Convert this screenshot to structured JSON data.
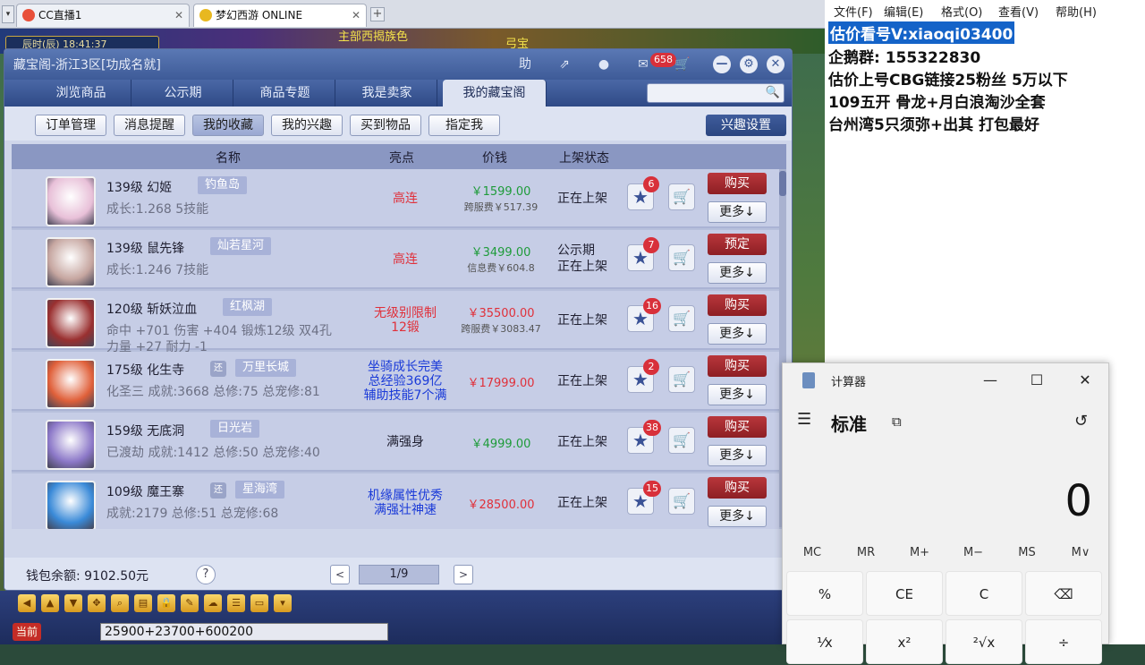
{
  "browser": {
    "tabs": [
      {
        "label": "CC直播1"
      },
      {
        "label": "梦幻西游 ONLINE"
      }
    ],
    "close": "✕",
    "plus": "+",
    "menu": "▾"
  },
  "game": {
    "clock": "辰时(辰)   18:41:37",
    "top_text_1": "主部西揭族色",
    "top_text_2": "弓宝",
    "chat_channel": "当前",
    "chat_text": "25900+23700+600200"
  },
  "window": {
    "title": "藏宝阁-浙江3区[功成名就]",
    "title_icons": {
      "help": "助",
      "pin": "⇗",
      "stop": "●",
      "msg_badge": "658",
      "min": "—",
      "settings": "⚙",
      "close": "✕"
    },
    "nav_tabs": [
      "浏览商品",
      "公示期",
      "商品专题",
      "我是卖家",
      "我的藏宝阁"
    ],
    "active_tab": 4,
    "sub_buttons": [
      "订单管理",
      "消息提醒",
      "我的收藏",
      "我的兴趣",
      "买到物品",
      "指定我"
    ],
    "active_sub": 2,
    "interest_btn": "兴趣设置",
    "columns": [
      "名称",
      "亮点",
      "价钱",
      "上架状态"
    ],
    "rows": [
      {
        "title": "139级 幻姬",
        "server": "钓鱼岛",
        "line2": "成长:1.268 5技能",
        "line3": "",
        "highlight": "高连",
        "hl_color": "red",
        "price": "￥1599.00",
        "price_color": "green",
        "fee": "跨服费￥517.39",
        "status": "正在上架",
        "status2": "",
        "fav_count": "6",
        "action": "购买",
        "more": "更多↓",
        "av": "#e8c0d8"
      },
      {
        "title": "139级 鼠先锋",
        "server": "灿若星河",
        "line2": "成长:1.246 7技能",
        "line3": "",
        "highlight": "高连",
        "hl_color": "red",
        "price": "￥3499.00",
        "price_color": "green",
        "fee": "信息费￥604.8",
        "status": "公示期",
        "status2": "正在上架",
        "fav_count": "7",
        "action": "预定",
        "more": "更多↓",
        "av": "#c6a6a0"
      },
      {
        "title": "120级 斩妖泣血",
        "server": "红枫湖",
        "line2": "命中 +701 伤害 +404 锻炼12级 双4孔",
        "line3": "力量 +27 耐力 -1",
        "highlight": "无级别限制\n12锻",
        "hl_color": "red",
        "price": "￥35500.00",
        "price_color": "red",
        "fee": "跨服费￥3083.47",
        "status": "正在上架",
        "status2": "",
        "fav_count": "16",
        "action": "购买",
        "more": "更多↓",
        "av": "#9a3030"
      },
      {
        "title": "175级 化生寺",
        "tag": "还",
        "server": "万里长城",
        "line2": "化圣三 成就:3668 总修:75 总宠修:81",
        "line3": "",
        "highlight": "坐骑成长完美\n总经验369亿\n辅助技能7个满",
        "hl_color": "blue",
        "price": "￥17999.00",
        "price_color": "red",
        "fee": "",
        "status": "正在上架",
        "status2": "",
        "fav_count": "2",
        "action": "购买",
        "more": "更多↓",
        "av": "#e0603a"
      },
      {
        "title": "159级 无底洞",
        "server": "日光岩",
        "line2": "已渡劫 成就:1412 总修:50 总宠修:40",
        "line3": "",
        "highlight": "满强身",
        "hl_color": "dark",
        "price": "￥4999.00",
        "price_color": "green",
        "fee": "",
        "status": "正在上架",
        "status2": "",
        "fav_count": "38",
        "action": "购买",
        "more": "更多↓",
        "av": "#8c78c8"
      },
      {
        "title": "109级 魔王寨",
        "tag": "还",
        "server": "星海湾",
        "line2": "成就:2179 总修:51 总宠修:68",
        "line3": "",
        "highlight": "机缘属性优秀\n满强壮神速",
        "hl_color": "blue",
        "price": "￥28500.00",
        "price_color": "red",
        "fee": "",
        "status": "正在上架",
        "status2": "",
        "fav_count": "15",
        "action": "购买",
        "more": "更多↓",
        "av": "#3a8ad8"
      }
    ],
    "wallet": "钱包余额: 9102.50元",
    "help": "?",
    "page": "1/9",
    "prev": "<",
    "next": ">",
    "star": "★",
    "cart": "🛒"
  },
  "notepad": {
    "menu": [
      "文件(F)",
      "编辑(E)",
      "格式(O)",
      "查看(V)",
      "帮助(H)"
    ],
    "lines": [
      "估价看号V:xiaoqi03400",
      "企鹅群:  155322830",
      "估价上号CBG链接25粉丝 5万以下",
      "109五开 骨龙+月白浪淘沙全套",
      "台州湾5只须弥+出其 打包最好"
    ]
  },
  "calculator": {
    "title": "计算器",
    "mode": "标准",
    "display": "0",
    "min": "—",
    "max": "☐",
    "close": "✕",
    "menu_icon": "☰",
    "pin_icon": "⧉",
    "history_icon": "↺",
    "memory": [
      "MC",
      "MR",
      "M+",
      "M−",
      "MS",
      "M∨"
    ],
    "keys_row1": [
      "%",
      "CE",
      "C",
      "⌫"
    ],
    "keys_row2": [
      "⅟x",
      "x²",
      "²√x",
      "÷"
    ]
  }
}
